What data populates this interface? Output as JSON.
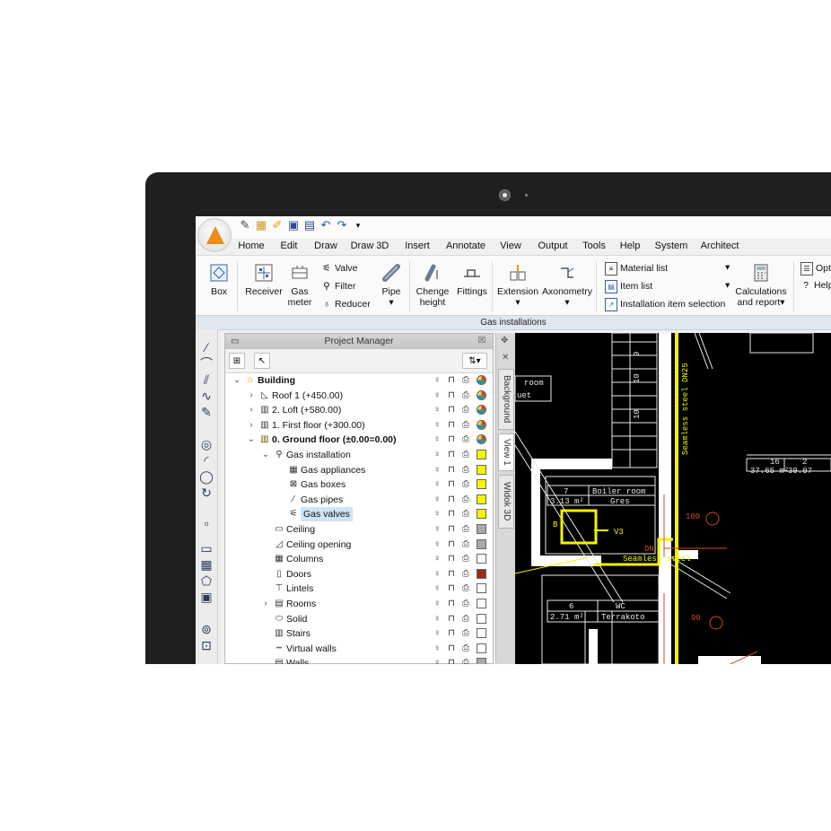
{
  "menu": [
    "Home",
    "Edit",
    "Draw",
    "Draw 3D",
    "Insert",
    "Annotate",
    "View",
    "Output",
    "Tools",
    "Help",
    "System",
    "Architect"
  ],
  "ribbon": {
    "box": "Box",
    "receiver": "Receiver",
    "gas_meter_1": "Gas",
    "gas_meter_2": "meter",
    "valve": "Valve",
    "filter": "Filter",
    "reducer": "Reducer",
    "pipe": "Pipe",
    "change_height_1": "Chenge",
    "change_height_2": "height",
    "fittings": "Fittings",
    "extension": "Extension",
    "axonometry": "Axonometry",
    "material_list": "Material list",
    "item_list": "Item list",
    "installation_item_selection": "Installation item selection",
    "calculations_1": "Calculations",
    "calculations_2": "and report",
    "options": "Opt",
    "help": "Help",
    "group_label": "Gas installations"
  },
  "project_manager": {
    "title": "Project Manager",
    "tree": [
      {
        "label": "Building",
        "level": 0,
        "toggle": "v",
        "bold": true,
        "swatch": "multi"
      },
      {
        "label": "Roof 1 (+450.00)",
        "level": 1,
        "toggle": ">",
        "swatch": "multi"
      },
      {
        "label": "2. Loft (+580.00)",
        "level": 1,
        "toggle": ">",
        "swatch": "multi"
      },
      {
        "label": "1. First floor (+300.00)",
        "level": 1,
        "toggle": ">",
        "swatch": "multi"
      },
      {
        "label": "0. Ground floor (±0.00=0.00)",
        "level": 1,
        "toggle": "v",
        "bold": true,
        "swatch": "multi"
      },
      {
        "label": "Gas installation",
        "level": 2,
        "toggle": "v",
        "swatch": "#f5f500"
      },
      {
        "label": "Gas appliances",
        "level": 3,
        "toggle": "",
        "swatch": "#f5f500"
      },
      {
        "label": "Gas boxes",
        "level": 3,
        "toggle": "",
        "swatch": "#f5f500"
      },
      {
        "label": "Gas pipes",
        "level": 3,
        "toggle": "",
        "swatch": "#f5f500"
      },
      {
        "label": "Gas valves",
        "level": 3,
        "toggle": "",
        "swatch": "#f5f500",
        "selected": true
      },
      {
        "label": "Ceiling",
        "level": 2,
        "toggle": "",
        "swatch": "#a8a8a8"
      },
      {
        "label": "Ceiling opening",
        "level": 2,
        "toggle": "",
        "swatch": "#a8a8a8"
      },
      {
        "label": "Columns",
        "level": 2,
        "toggle": "",
        "swatch": "#ffffff"
      },
      {
        "label": "Doors",
        "level": 2,
        "toggle": "",
        "swatch": "#9b2a1a"
      },
      {
        "label": "Lintels",
        "level": 2,
        "toggle": "",
        "swatch": "#ffffff"
      },
      {
        "label": "Rooms",
        "level": 2,
        "toggle": ">",
        "swatch": "#ffffff"
      },
      {
        "label": "Solid",
        "level": 2,
        "toggle": "",
        "swatch": "#ffffff"
      },
      {
        "label": "Stairs",
        "level": 2,
        "toggle": "",
        "swatch": "#ffffff"
      },
      {
        "label": "Virtual walls",
        "level": 2,
        "toggle": "",
        "swatch": "#ffffff"
      },
      {
        "label": "Walls",
        "level": 2,
        "toggle": "",
        "swatch": "#a8a8a8"
      }
    ]
  },
  "tabs": [
    "Background",
    "View 1",
    "Widok 3D"
  ],
  "cad": {
    "room_label_1": "room",
    "room_label_2": "uet",
    "boiler_num": "7",
    "boiler_name": "Boiler room",
    "boiler_area": "3.13 m²",
    "boiler_floor": "Gres",
    "wc_num": "6",
    "wc_name": "WC",
    "wc_area": "2.71 m²",
    "wc_floor": "Terrakoto",
    "r16_num": "16",
    "r16_area": "37.65 m²",
    "r2_num": "2",
    "r2_area": "39.07",
    "valve_tag": "V3",
    "pipe_label_vertical": "Seamless steel DN25",
    "pipe_label_horizontal": "Seamless steel",
    "dn": "DN",
    "dim_100": "100",
    "dim_90": "90",
    "stair_10a": "10",
    "stair_10b": "10",
    "stair_9": "9",
    "b_tag": "B"
  },
  "colors": {
    "accent": "#f08a1c",
    "cad_bg": "#000000",
    "gas": "#f2f200",
    "dim": "#d44a1c"
  }
}
